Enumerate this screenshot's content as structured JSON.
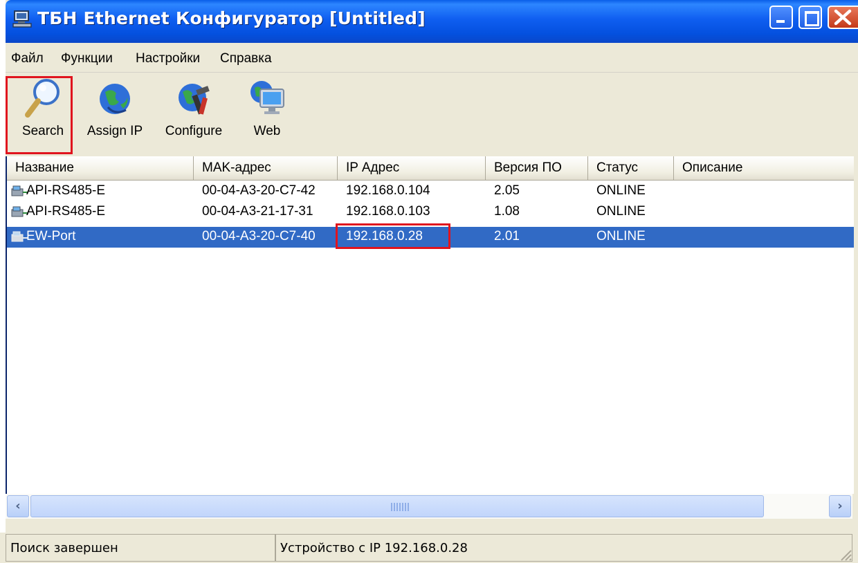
{
  "window": {
    "title": "ТБН Ethernet Конфигуратор [Untitled]"
  },
  "menu": [
    "Файл",
    "Функции",
    "Настройки",
    "Справка"
  ],
  "toolbar": [
    {
      "label": "Search",
      "icon": "magnifier-icon"
    },
    {
      "label": "Assign IP",
      "icon": "globe-icon"
    },
    {
      "label": "Configure",
      "icon": "globe-tools-icon"
    },
    {
      "label": "Web",
      "icon": "globe-monitor-icon"
    }
  ],
  "columns": [
    "Название",
    "MAK-адрес",
    "IP Адрес",
    "Версия ПО",
    "Статус",
    "Описание"
  ],
  "devices": [
    {
      "name": "API-RS485-E",
      "mac": "00-04-A3-20-C7-42",
      "ip": "192.168.0.104",
      "version": "2.05",
      "status": "ONLINE",
      "description": ""
    },
    {
      "name": "API-RS485-E",
      "mac": "00-04-A3-21-17-31",
      "ip": "192.168.0.103",
      "version": "1.08",
      "status": "ONLINE",
      "description": ""
    },
    {
      "name": "EW-Port",
      "mac": "00-04-A3-20-C7-40",
      "ip": "192.168.0.28",
      "version": "2.01",
      "status": "ONLINE",
      "description": ""
    }
  ],
  "selected_row": 2,
  "statusbar": {
    "left": "Поиск завершен",
    "right": "Устройство с IP 192.168.0.28"
  },
  "colors": {
    "titlebar": "#0a5ee8",
    "selection": "#316ac5",
    "highlight": "#e0141e"
  }
}
